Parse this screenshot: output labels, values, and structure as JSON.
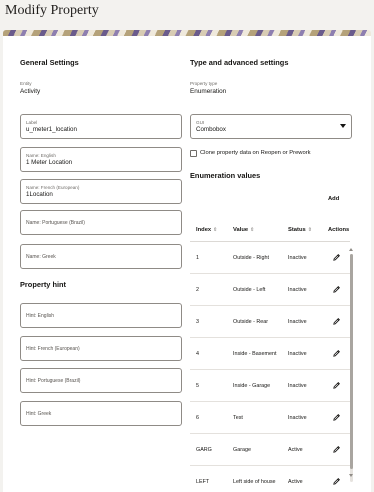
{
  "window": {
    "title": "Modify Property"
  },
  "general": {
    "heading": "General Settings",
    "entity_label": "Entity",
    "entity_value": "Activity",
    "fields": [
      {
        "label": "Label",
        "value": "u_meter1_location",
        "placeholder": ""
      },
      {
        "label": "Name: English",
        "value": "1 Meter Location",
        "placeholder": ""
      },
      {
        "label": "Name: French (European)",
        "value": "1Location",
        "placeholder": ""
      },
      {
        "label": "",
        "value": "",
        "placeholder": "Name: Portuguese (Brazil)"
      },
      {
        "label": "",
        "value": "",
        "placeholder": "Name: Greek"
      }
    ]
  },
  "hint": {
    "heading": "Property hint",
    "fields": [
      {
        "placeholder": "Hint: English"
      },
      {
        "placeholder": "Hint: French (European)"
      },
      {
        "placeholder": "Hint: Portuguese (Brazil)"
      },
      {
        "placeholder": "Hint: Greek"
      }
    ]
  },
  "type": {
    "heading": "Type and advanced settings",
    "property_type_label": "Property type",
    "property_type_value": "Enumeration",
    "gui_label": "GUI",
    "gui_value": "Combobox",
    "clone_label": "Clone property data on Reopen or Prework"
  },
  "enumeration": {
    "heading": "Enumeration values",
    "add_label": "Add",
    "columns": [
      "Index",
      "Value",
      "Status",
      "Actions"
    ],
    "rows": [
      {
        "index": "1",
        "value": "Outside - Right",
        "status": "Inactive"
      },
      {
        "index": "2",
        "value": "Outside - Left",
        "status": "Inactive"
      },
      {
        "index": "3",
        "value": "Outside - Rear",
        "status": "Inactive"
      },
      {
        "index": "4",
        "value": "Inside - Basement",
        "status": "Inactive"
      },
      {
        "index": "5",
        "value": "Inside - Garage",
        "status": "Inactive"
      },
      {
        "index": "6",
        "value": "Test",
        "status": "Inactive"
      },
      {
        "index": "GARG",
        "value": "Garage",
        "status": "Active"
      },
      {
        "index": "LEFT",
        "value": "Left side of house",
        "status": "Active"
      }
    ]
  },
  "icons": {
    "edit": "pencil-icon",
    "sort": "sort-icon",
    "dropdown": "chevron-down-icon"
  }
}
